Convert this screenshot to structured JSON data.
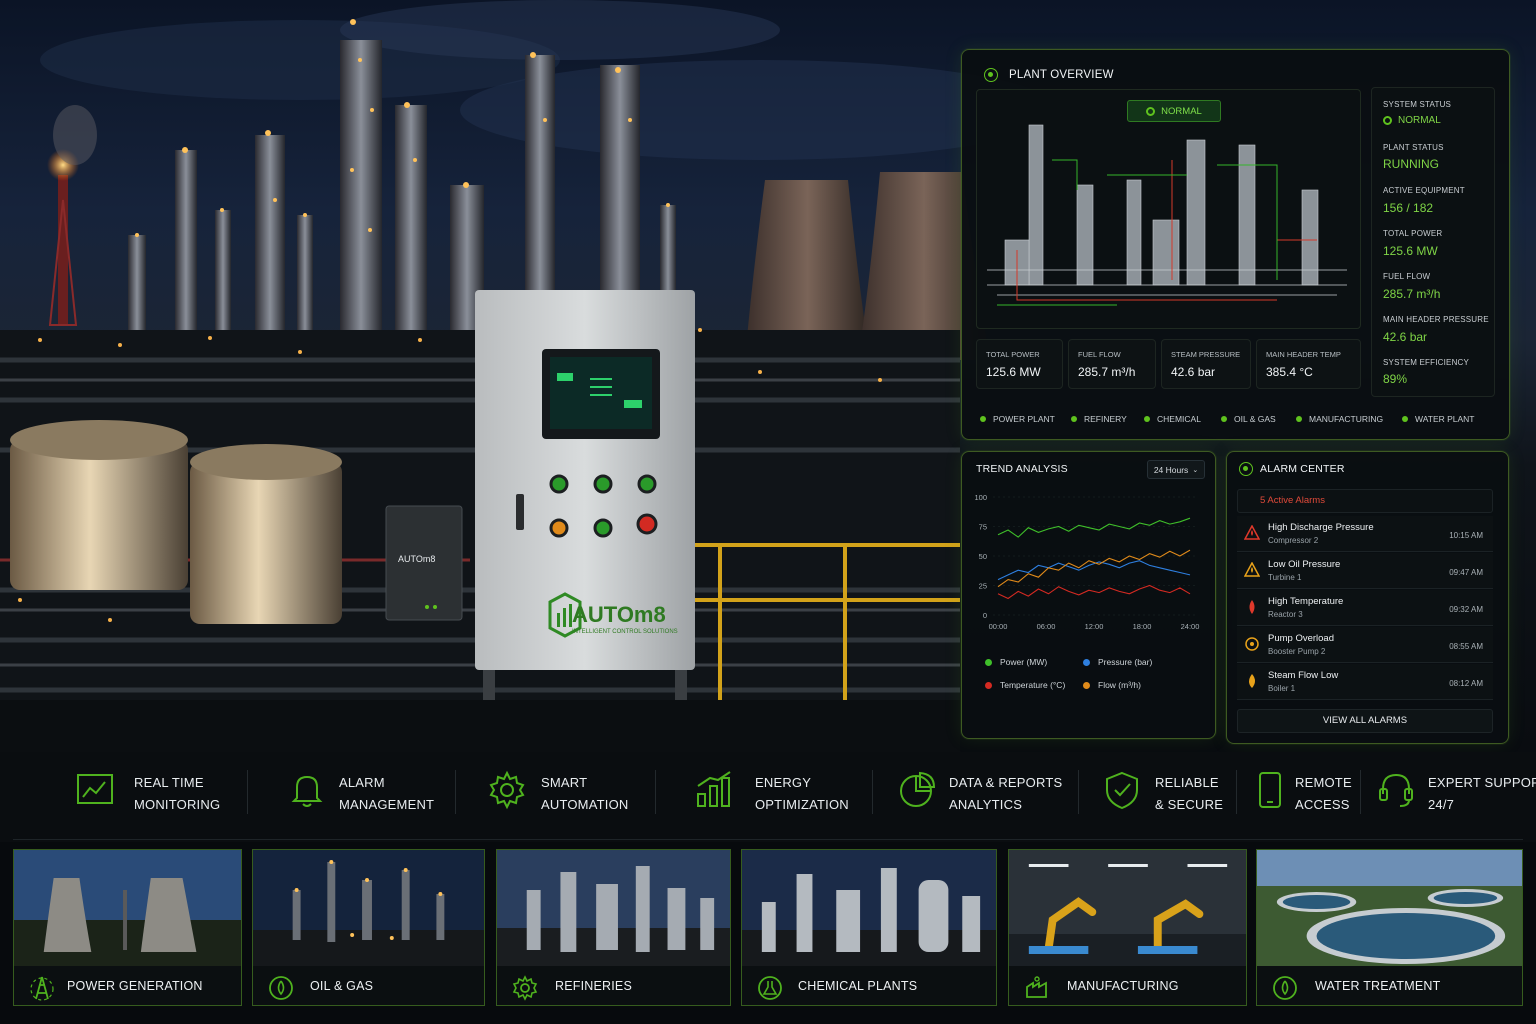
{
  "plant_overview": {
    "title": "PLANT OVERVIEW",
    "mode_badge": "NORMAL",
    "status": [
      {
        "label": "SYSTEM STATUS",
        "value": "NORMAL"
      },
      {
        "label": "PLANT STATUS",
        "value": "RUNNING"
      },
      {
        "label": "ACTIVE EQUIPMENT",
        "value": "156 / 182"
      },
      {
        "label": "TOTAL POWER",
        "value": "125.6 MW"
      },
      {
        "label": "FUEL FLOW",
        "value": "285.7 m³/h"
      },
      {
        "label": "MAIN HEADER PRESSURE",
        "value": "42.6 bar"
      },
      {
        "label": "SYSTEM EFFICIENCY",
        "value": "89%"
      }
    ],
    "kpis": [
      {
        "label": "TOTAL POWER",
        "value": "125.6 MW"
      },
      {
        "label": "FUEL FLOW",
        "value": "285.7 m³/h"
      },
      {
        "label": "STEAM PRESSURE",
        "value": "42.6 bar"
      },
      {
        "label": "MAIN HEADER TEMP",
        "value": "385.4 °C"
      }
    ],
    "categories": [
      "POWER PLANT",
      "REFINERY",
      "CHEMICAL",
      "OIL & GAS",
      "MANUFACTURING",
      "WATER PLANT"
    ]
  },
  "trend": {
    "title": "TREND ANALYSIS",
    "range": "24 Hours",
    "legend": [
      "Power (MW)",
      "Pressure (bar)",
      "Temperature (°C)",
      "Flow (m³/h)"
    ]
  },
  "chart_data": {
    "type": "line",
    "x": [
      "00:00",
      "06:00",
      "12:00",
      "18:00",
      "24:00"
    ],
    "ylim": [
      0,
      100
    ],
    "yticks": [
      0,
      25,
      50,
      75,
      100
    ],
    "series": [
      {
        "name": "Power (MW)",
        "color": "#3fbf2a",
        "values": [
          68,
          72,
          66,
          74,
          70,
          73,
          75,
          71,
          76,
          74,
          72,
          77,
          75,
          73,
          78,
          76,
          80,
          77,
          79,
          82
        ]
      },
      {
        "name": "Pressure (bar)",
        "color": "#2e7fe0",
        "values": [
          30,
          34,
          38,
          36,
          42,
          40,
          44,
          41,
          38,
          42,
          45,
          43,
          40,
          44,
          46,
          42,
          40,
          38,
          36,
          34
        ]
      },
      {
        "name": "Temperature (°C)",
        "color": "#d42a22",
        "values": [
          18,
          14,
          20,
          16,
          22,
          18,
          24,
          20,
          17,
          21,
          19,
          23,
          20,
          18,
          22,
          25,
          21,
          19,
          23,
          18
        ]
      },
      {
        "name": "Flow (m³/h)",
        "color": "#e08a1a",
        "values": [
          24,
          30,
          28,
          35,
          32,
          40,
          38,
          44,
          40,
          46,
          43,
          48,
          45,
          50,
          47,
          52,
          49,
          54,
          50,
          55
        ]
      }
    ]
  },
  "alarms": {
    "title": "ALARM CENTER",
    "count_text": "5 Active Alarms",
    "items": [
      {
        "title": "High Discharge Pressure",
        "source": "Compressor 2",
        "time": "10:15 AM",
        "severity": "critical"
      },
      {
        "title": "Low Oil Pressure",
        "source": "Turbine 1",
        "time": "09:47 AM",
        "severity": "warning"
      },
      {
        "title": "High Temperature",
        "source": "Reactor 3",
        "time": "09:32 AM",
        "severity": "critical"
      },
      {
        "title": "Pump Overload",
        "source": "Booster Pump 2",
        "time": "08:55 AM",
        "severity": "warning"
      },
      {
        "title": "Steam Flow Low",
        "source": "Boiler 1",
        "time": "08:12 AM",
        "severity": "warning"
      }
    ],
    "view_all": "VIEW ALL ALARMS"
  },
  "brand": {
    "name": "AUTOm8",
    "tagline": "INTELLIGENT CONTROL SOLUTIONS",
    "accent": "#5fc21e"
  },
  "features": [
    {
      "line1": "REAL TIME",
      "line2": "MONITORING",
      "icon": "monitor-chart-icon"
    },
    {
      "line1": "ALARM",
      "line2": "MANAGEMENT",
      "icon": "bell-icon"
    },
    {
      "line1": "SMART",
      "line2": "AUTOMATION",
      "icon": "gear-icon"
    },
    {
      "line1": "ENERGY",
      "line2": "OPTIMIZATION",
      "icon": "bar-chart-icon"
    },
    {
      "line1": "DATA & REPORTS",
      "line2": "ANALYTICS",
      "icon": "pie-chart-icon"
    },
    {
      "line1": "RELIABLE",
      "line2": "& SECURE",
      "icon": "shield-check-icon"
    },
    {
      "line1": "REMOTE",
      "line2": "ACCESS",
      "icon": "mobile-icon"
    },
    {
      "line1": "EXPERT SUPPORT",
      "line2": "24/7",
      "icon": "headset-icon"
    }
  ],
  "industries": [
    {
      "label": "POWER GENERATION",
      "icon": "power-tower-icon"
    },
    {
      "label": "OIL & GAS",
      "icon": "oil-drop-icon"
    },
    {
      "label": "REFINERIES",
      "icon": "gear-icon"
    },
    {
      "label": "CHEMICAL PLANTS",
      "icon": "flask-icon"
    },
    {
      "label": "MANUFACTURING",
      "icon": "factory-icon"
    },
    {
      "label": "WATER TREATMENT",
      "icon": "water-drop-icon"
    }
  ]
}
